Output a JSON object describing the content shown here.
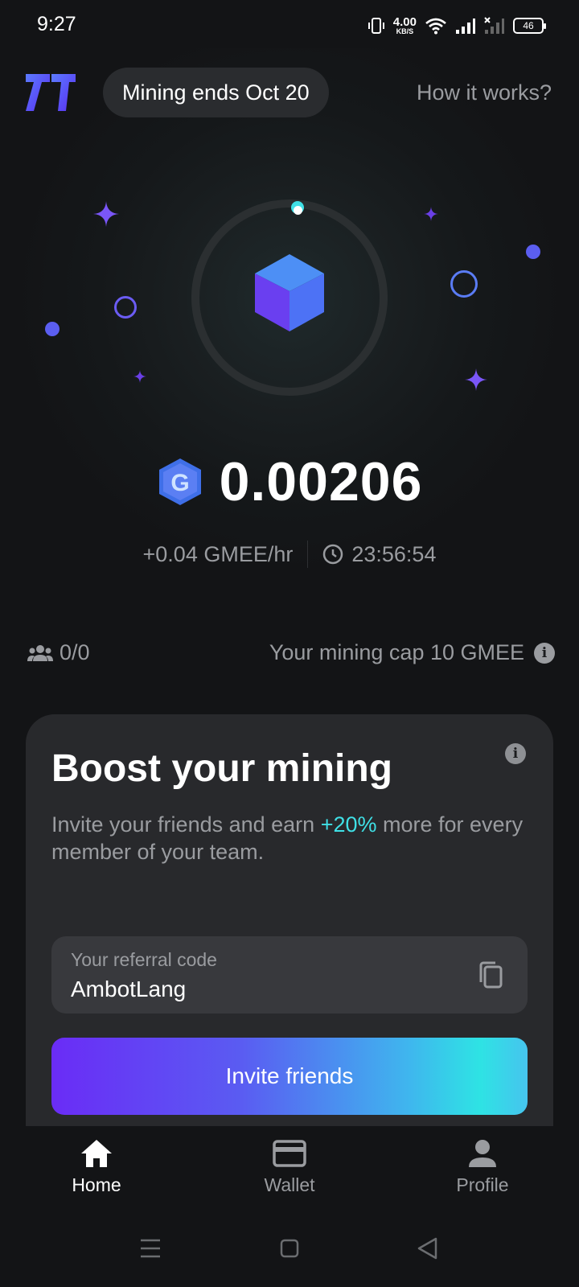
{
  "status_bar": {
    "time": "9:27",
    "net_speed_value": "4.00",
    "net_speed_unit": "KB/S",
    "battery": "46"
  },
  "header": {
    "mining_pill": "Mining ends Oct 20",
    "how_link": "How it works?"
  },
  "mining": {
    "balance": "0.00206",
    "rate": "+0.04 GMEE/hr",
    "timer": "23:56:54"
  },
  "team": {
    "count": "0/0",
    "cap": "Your mining cap 10 GMEE"
  },
  "boost_card": {
    "title": "Boost your mining",
    "text_before": "Invite your friends and earn ",
    "highlight": "+20%",
    "text_after": " more for every member of your team.",
    "referral_label": "Your referral code",
    "referral_code": "AmbotLang",
    "invite_label": "Invite friends"
  },
  "bottom_nav": {
    "home": "Home",
    "wallet": "Wallet",
    "profile": "Profile"
  },
  "colors": {
    "background": "#131416",
    "accent_cyan": "#3fe0e6",
    "accent_purple": "#6a2cf6"
  },
  "icons": [
    "logo",
    "vibrate-icon",
    "wifi-icon",
    "signal-icon",
    "battery-icon",
    "sparkle-icon",
    "cube-icon",
    "gmee-coin-icon",
    "clock-icon",
    "team-icon",
    "info-icon",
    "copy-icon",
    "home-icon",
    "wallet-icon",
    "profile-icon"
  ]
}
